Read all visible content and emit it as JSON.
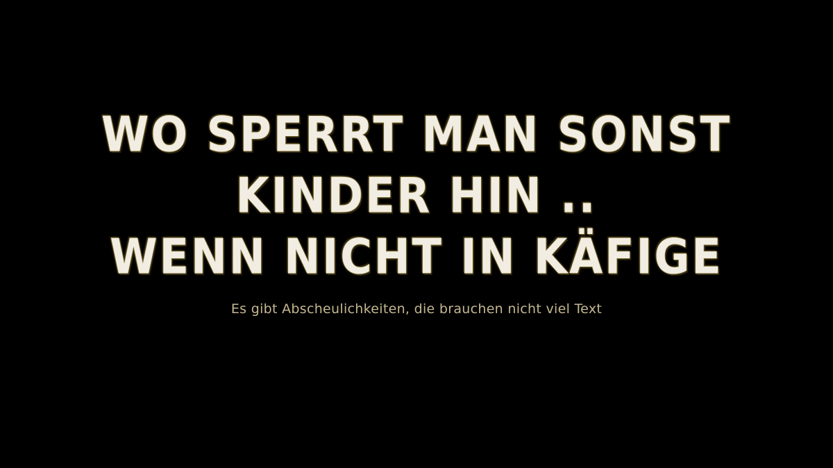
{
  "headline": {
    "lines": [
      "WO SPERRT MAN SONST",
      "KINDER HIN ..",
      "WENN NICHT IN KÄFIGE"
    ]
  },
  "subline": "Es gibt Abscheulichkeiten, die brauchen nicht viel Text",
  "colors": {
    "background": "#000000",
    "headline_fill": "#f1ede2",
    "headline_outline": "#6b5a24",
    "subline": "#c4b790"
  }
}
